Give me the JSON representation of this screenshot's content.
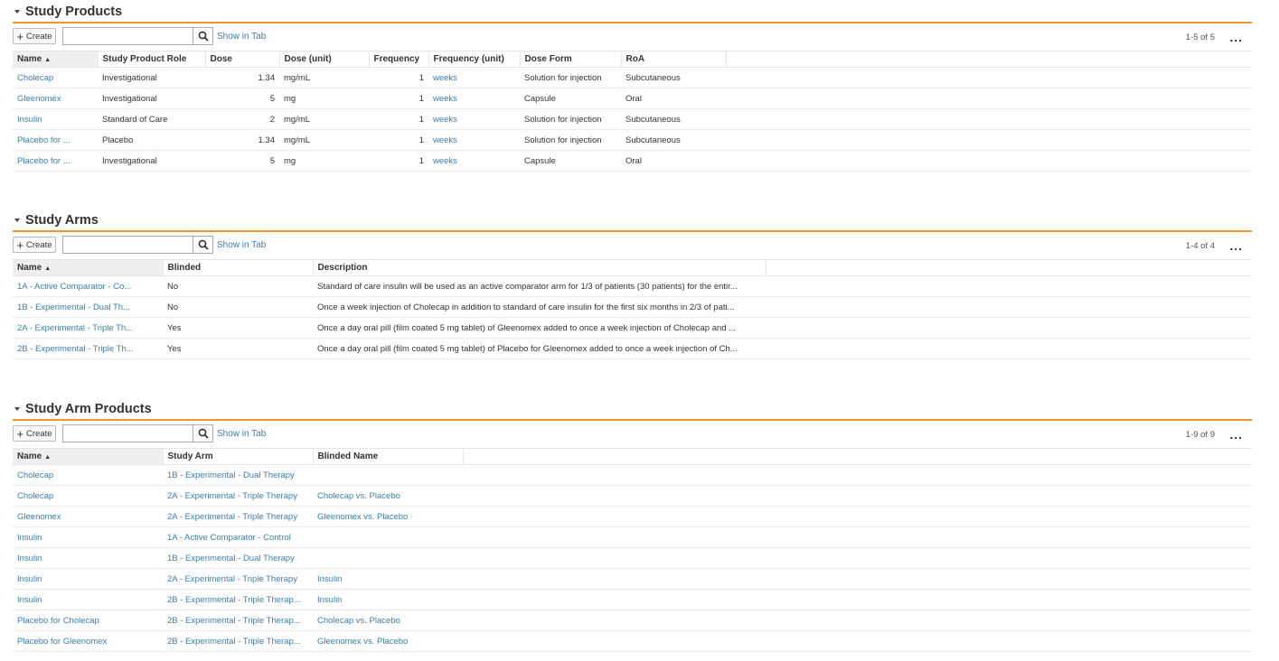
{
  "common": {
    "create_label": "Create",
    "show_in_tab": "Show in Tab",
    "more": "..."
  },
  "products": {
    "title": "Study Products",
    "pager": "1-5 of 5",
    "headers": [
      "Name",
      "Study Product Role",
      "Dose",
      "Dose (unit)",
      "Frequency",
      "Frequency (unit)",
      "Dose Form",
      "RoA"
    ],
    "rows": [
      [
        "Cholecap",
        "Investigational",
        "1.34",
        "mg/mL",
        "1",
        "weeks",
        "Solution for injection",
        "Subcutaneous"
      ],
      [
        "Gleenomex",
        "Investigational",
        "5",
        "mg",
        "1",
        "weeks",
        "Capsule",
        "Oral"
      ],
      [
        "Insulin",
        "Standard of Care",
        "2",
        "mg/mL",
        "1",
        "weeks",
        "Solution for injection",
        "Subcutaneous"
      ],
      [
        "Placebo for ...",
        "Placebo",
        "1.34",
        "mg/mL",
        "1",
        "weeks",
        "Solution for injection",
        "Subcutaneous"
      ],
      [
        "Placebo for ...",
        "Investigational",
        "5",
        "mg",
        "1",
        "weeks",
        "Capsule",
        "Oral"
      ]
    ]
  },
  "arms": {
    "title": "Study Arms",
    "pager": "1-4 of 4",
    "headers": [
      "Name",
      "Blinded",
      "Description"
    ],
    "rows": [
      [
        "1A - Active Comparator - Co...",
        "No",
        "Standard of care insulin will be used as an active comparator arm for 1/3 of patients (30 patients) for the entir..."
      ],
      [
        "1B - Experimental - Dual Th...",
        "No",
        "Once a week injection of Cholecap in addition to standard of care insulin for the first six months in 2/3 of pati..."
      ],
      [
        "2A - Experimental - Triple Th...",
        "Yes",
        "Once a day oral pill (film coated 5 mg tablet) of Gleenomex added to once a week injection of Cholecap and ..."
      ],
      [
        "2B - Experimental - Triple Th...",
        "Yes",
        "Once a day oral pill (film coated 5 mg tablet) of Placebo for Gleenomex added to once a week injection of Ch..."
      ]
    ]
  },
  "arm_products": {
    "title": "Study Arm Products",
    "pager": "1-9 of 9",
    "headers": [
      "Name",
      "Study Arm",
      "Blinded Name"
    ],
    "rows": [
      [
        "Cholecap",
        "1B - Experimental - Dual Therapy",
        ""
      ],
      [
        "Cholecap",
        "2A - Experimental - Triple Therapy",
        "Cholecap vs. Placebo"
      ],
      [
        "Gleenomex",
        "2A - Experimental - Triple Therapy",
        "Gleenomex vs. Placebo"
      ],
      [
        "Insulin",
        "1A - Active Comparator - Control",
        ""
      ],
      [
        "Insulin",
        "1B - Experimental - Dual Therapy",
        ""
      ],
      [
        "Insulin",
        "2A - Experimental - Triple Therapy",
        "Insulin"
      ],
      [
        "Insulin",
        "2B - Experimental - Triple Therap...",
        "Insulin"
      ],
      [
        "Placebo for Cholecap",
        "2B - Experimental - Triple Therap...",
        "Cholecap vs. Placebo"
      ],
      [
        "Placebo for Gleenomex",
        "2B - Experimental - Triple Therap...",
        "Gleenomex vs. Placebo"
      ]
    ]
  },
  "colors": {
    "accent": "#f0962c",
    "link": "#3a7fb0"
  }
}
